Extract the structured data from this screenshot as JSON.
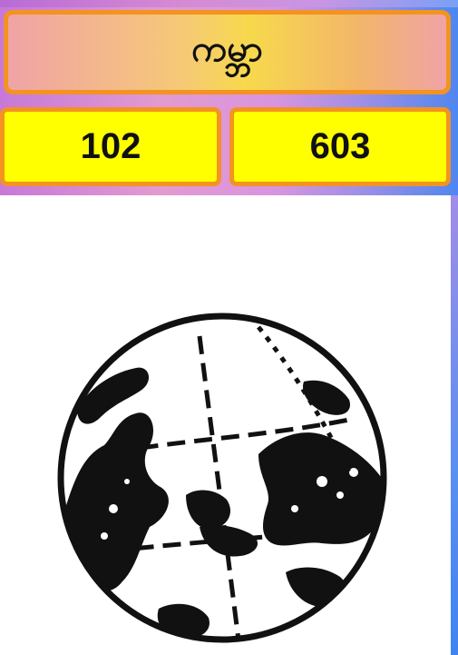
{
  "title": "ကမ္ဘာ",
  "counts": {
    "left": "102",
    "right": "603"
  },
  "image": {
    "icon": "globe-icon"
  },
  "colors": {
    "accent_border": "#f39320",
    "count_background": "#ffff00",
    "panel_background": "#ffffff"
  }
}
